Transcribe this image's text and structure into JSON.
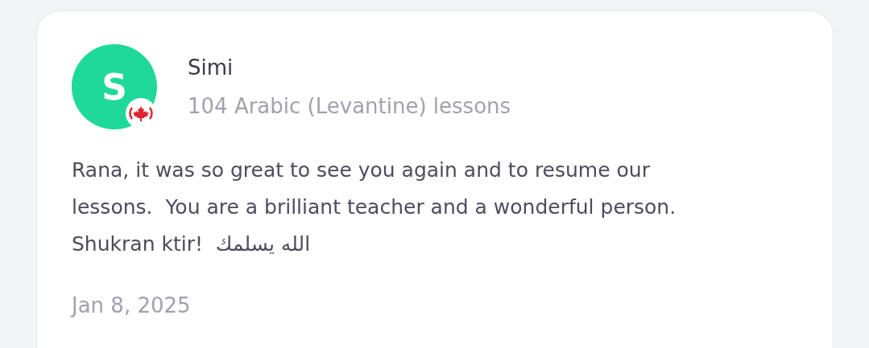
{
  "review": {
    "avatar_initial": "S",
    "reviewer_name": "Simi",
    "lessons": "104 Arabic (Levantine) lessons",
    "text": "Rana, it was so great to see you again and to resume our lessons.  You are a brilliant teacher and a wonderful person.  Shukran ktir!  الله يسلمك",
    "date": "Jan 8, 2025"
  }
}
